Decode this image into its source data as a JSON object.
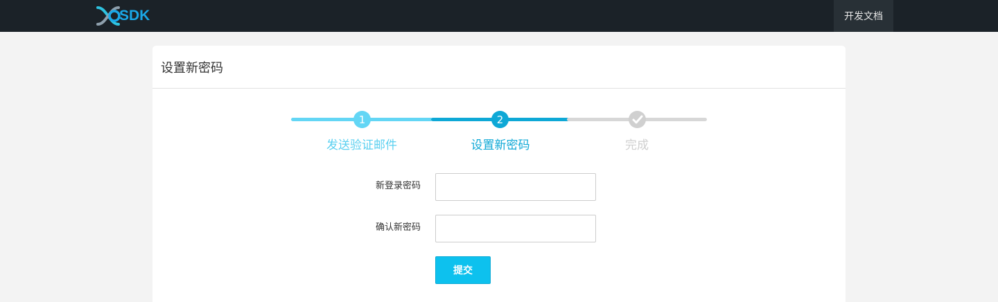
{
  "nav": {
    "logo_text": "SDK",
    "docs_label": "开发文档"
  },
  "card": {
    "title": "设置新密码"
  },
  "steps": [
    {
      "number": "1",
      "label": "发送验证邮件",
      "status": "done"
    },
    {
      "number": "2",
      "label": "设置新密码",
      "status": "active"
    },
    {
      "number": "",
      "label": "完成",
      "status": "pending",
      "icon": "check-icon"
    }
  ],
  "form": {
    "new_password_label": "新登录密码",
    "new_password_value": "",
    "confirm_password_label": "确认新密码",
    "confirm_password_value": "",
    "submit_label": "提交"
  },
  "colors": {
    "topbar": "#1b2228",
    "brand": "#1aa8e8",
    "step_done": "#63d6f5",
    "step_active": "#0ea8d6",
    "step_pending": "#d7d7d7",
    "button": "#0dc1ee"
  }
}
